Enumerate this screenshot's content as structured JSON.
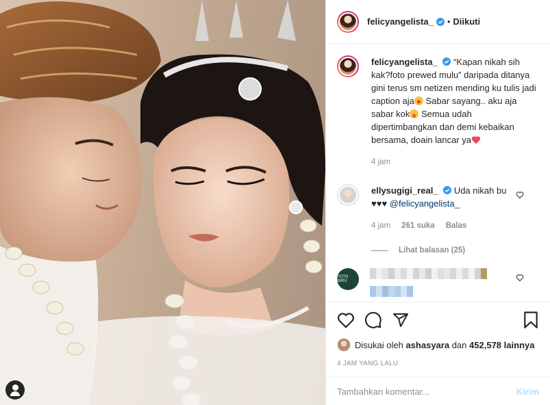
{
  "post": {
    "username": "felicyangelista_",
    "follow_status": "Diikuti",
    "separator": "•"
  },
  "caption": {
    "username": "felicyangelista_",
    "text_1": "“Kapan nikah sih kak?foto prewed mulu” daripada ditanya gini terus sm netizen mending ku tulis jadi caption aja",
    "text_2": " Sabar sayang.. aku aja sabar kok",
    "text_3": " Semua udah dipertimbangkan dan demi kebaikan bersama, doain lancar ya",
    "time": "4 jam"
  },
  "comment_1": {
    "username": "ellysugigi_real_",
    "text": "Uda nikah bu",
    "hearts": "♥♥♥",
    "mention": "@felicyangelista_",
    "time": "4 jam",
    "likes": "261 suka",
    "reply": "Balas",
    "view_replies": "Lihat balasan (25)"
  },
  "comment_2": {
    "avatar_text": "FOTO BIRU"
  },
  "footer": {
    "liked_by_prefix": "Disukai oleh ",
    "liked_by_user": "ashasyara",
    "liked_by_mid": " dan ",
    "liked_by_count": "452,578 lainnya",
    "time_ago": "4 JAM YANG LALU",
    "comment_placeholder": "Tambahkan komentar...",
    "post_label": "Kirim"
  },
  "colors": {
    "verified": "#3897f0",
    "link": "#00376b",
    "muted": "#8e8e8e",
    "post_disabled": "#b2dffc",
    "heart_red": "#ed4956"
  },
  "icons": [
    "verified-icon",
    "heart-icon",
    "comment-icon",
    "share-icon",
    "bookmark-icon",
    "user-tag-icon"
  ]
}
